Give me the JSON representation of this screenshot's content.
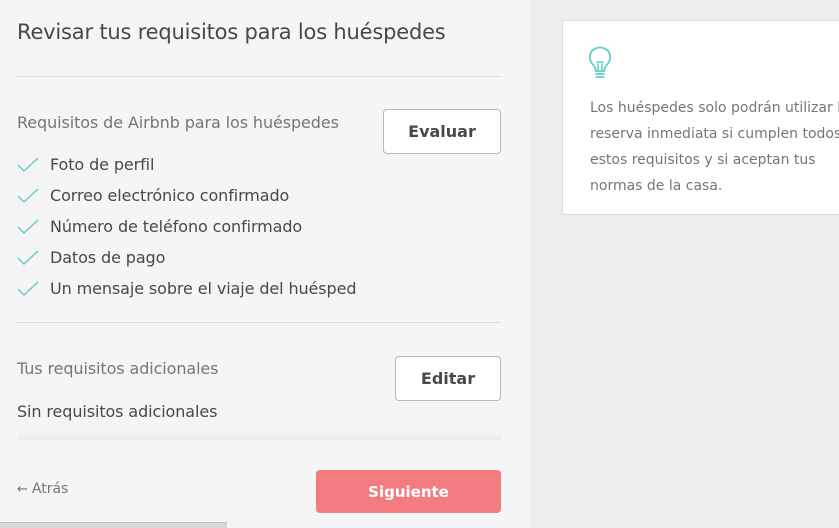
{
  "page": {
    "title": "Revisar tus requisitos para los huéspedes"
  },
  "airbnb_requirements": {
    "label": "Requisitos de Airbnb para los huéspedes",
    "evaluate_button": "Evaluar",
    "items": [
      "Foto de perfil",
      "Correo electrónico confirmado",
      "Número de teléfono confirmado",
      "Datos de pago",
      "Un mensaje sobre el viaje del huésped"
    ]
  },
  "additional_requirements": {
    "label": "Tus requisitos adicionales",
    "edit_button": "Editar",
    "value": "Sin requisitos adicionales"
  },
  "footer": {
    "back_arrow": "←",
    "back_label": "Atrás",
    "next_label": "Siguiente"
  },
  "tip": {
    "icon": "lightbulb-icon",
    "text": "Los huéspedes solo podrán utilizar la reserva inmediata si cumplen todos estos requisitos y si aceptan tus normas de la casa."
  },
  "colors": {
    "accent_teal": "#5fcfc3",
    "primary_button": "#f27c80",
    "text_primary": "#484848",
    "text_secondary": "#767676"
  }
}
